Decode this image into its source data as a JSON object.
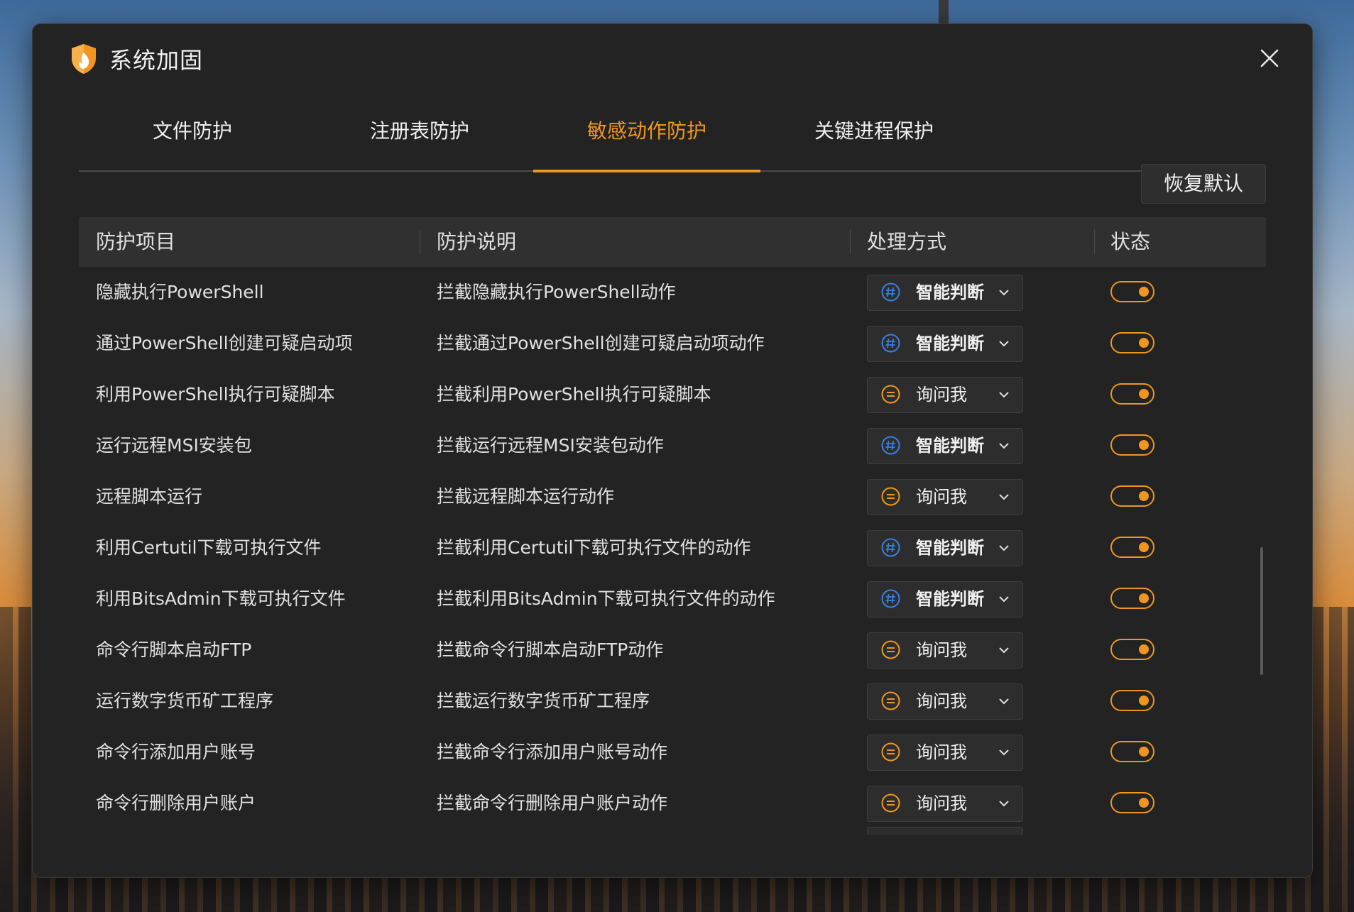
{
  "app": {
    "title": "系统加固"
  },
  "tabs": [
    {
      "label": "文件防护",
      "active": false
    },
    {
      "label": "注册表防护",
      "active": false
    },
    {
      "label": "敏感动作防护",
      "active": true
    },
    {
      "label": "关键进程保护",
      "active": false
    }
  ],
  "toolbar": {
    "restore_label": "恢复默认"
  },
  "table": {
    "headers": {
      "item": "防护项目",
      "desc": "防护说明",
      "method": "处理方式",
      "status": "状态"
    },
    "rows": [
      {
        "name": "隐藏执行PowerShell",
        "desc": "拦截隐藏执行PowerShell动作",
        "method": "智能判断",
        "method_icon": "hash-icon",
        "enabled": true
      },
      {
        "name": "通过PowerShell创建可疑启动项",
        "desc": "拦截通过PowerShell创建可疑启动项动作",
        "method": "智能判断",
        "method_icon": "hash-icon",
        "enabled": true
      },
      {
        "name": "利用PowerShell执行可疑脚本",
        "desc": "拦截利用PowerShell执行可疑脚本",
        "method": "询问我",
        "method_icon": "equals-icon",
        "enabled": true
      },
      {
        "name": "运行远程MSI安装包",
        "desc": "拦截运行远程MSI安装包动作",
        "method": "智能判断",
        "method_icon": "hash-icon",
        "enabled": true
      },
      {
        "name": "远程脚本运行",
        "desc": "拦截远程脚本运行动作",
        "method": "询问我",
        "method_icon": "equals-icon",
        "enabled": true
      },
      {
        "name": "利用Certutil下载可执行文件",
        "desc": "拦截利用Certutil下载可执行文件的动作",
        "method": "智能判断",
        "method_icon": "hash-icon",
        "enabled": true
      },
      {
        "name": "利用BitsAdmin下载可执行文件",
        "desc": "拦截利用BitsAdmin下载可执行文件的动作",
        "method": "智能判断",
        "method_icon": "hash-icon",
        "enabled": true
      },
      {
        "name": "命令行脚本启动FTP",
        "desc": "拦截命令行脚本启动FTP动作",
        "method": "询问我",
        "method_icon": "equals-icon",
        "enabled": true
      },
      {
        "name": "运行数字货币矿工程序",
        "desc": "拦截运行数字货币矿工程序",
        "method": "询问我",
        "method_icon": "equals-icon",
        "enabled": true
      },
      {
        "name": "命令行添加用户账号",
        "desc": "拦截命令行添加用户账号动作",
        "method": "询问我",
        "method_icon": "equals-icon",
        "enabled": true
      },
      {
        "name": "命令行删除用户账户",
        "desc": "拦截命令行删除用户账户动作",
        "method": "询问我",
        "method_icon": "equals-icon",
        "enabled": true
      }
    ]
  },
  "colors": {
    "accent": "#f0961e",
    "smart_icon": "#3a7fe0",
    "window_bg": "#232323"
  }
}
